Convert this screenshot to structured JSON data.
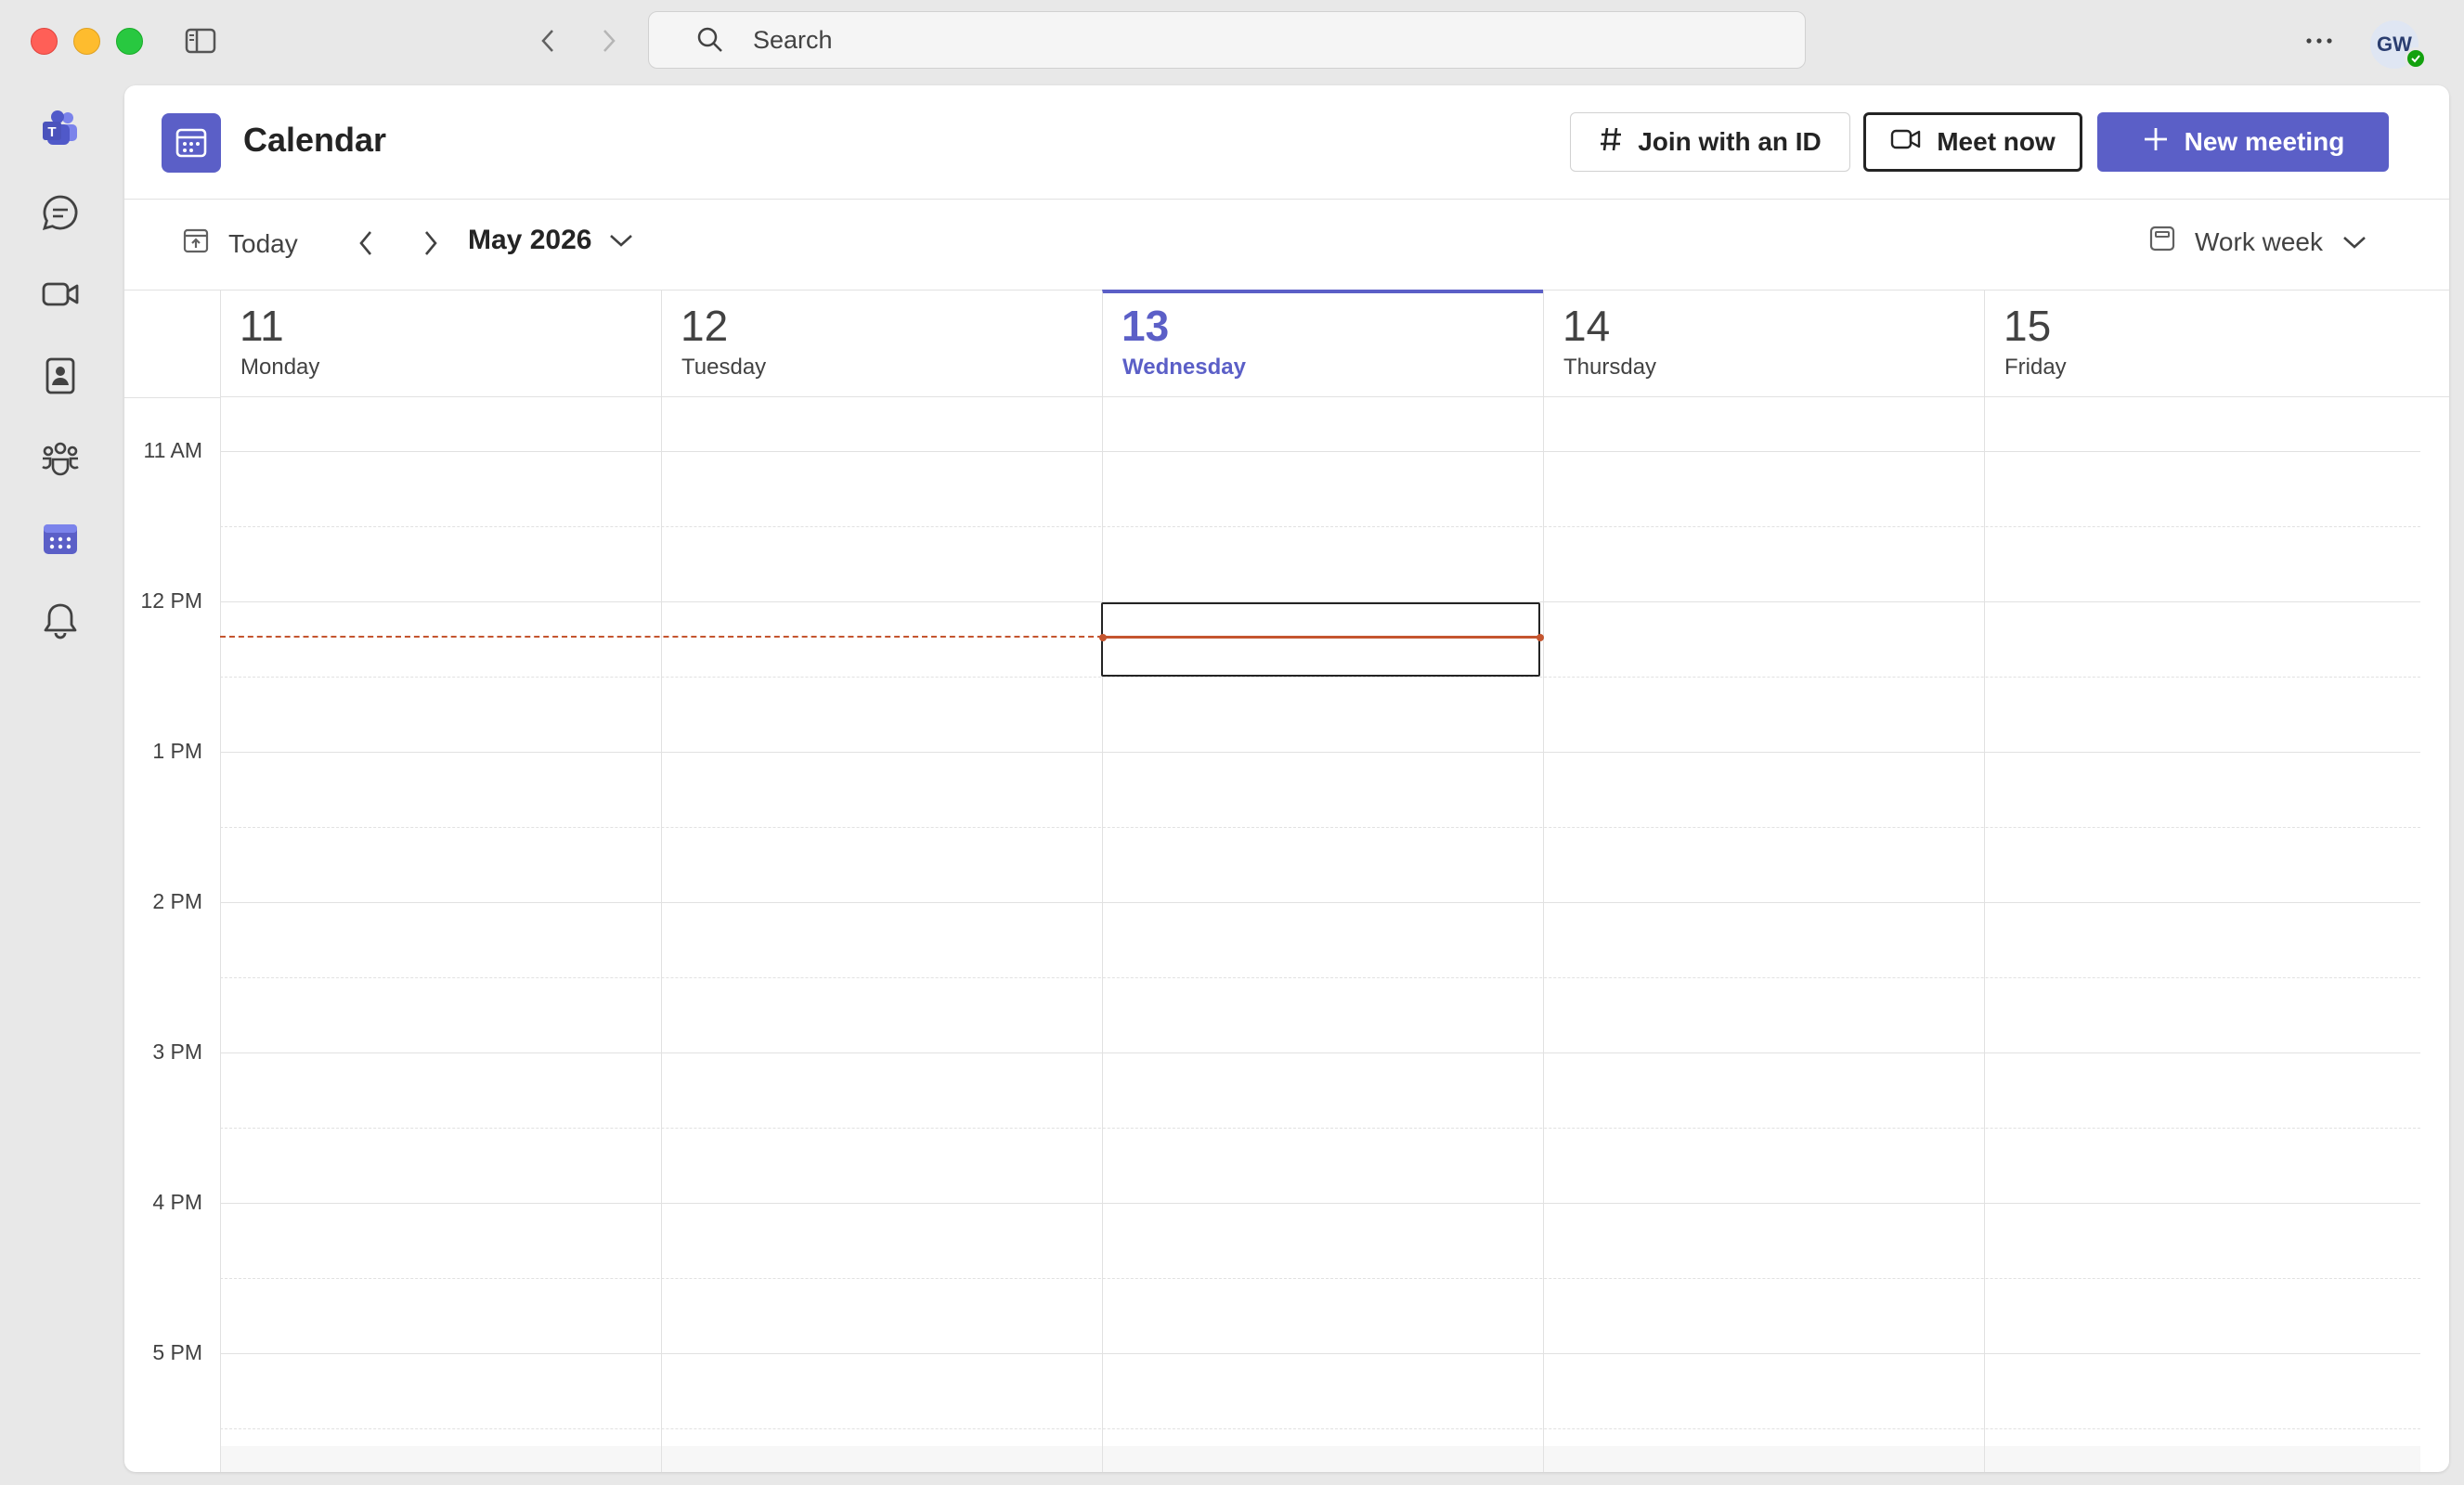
{
  "search": {
    "placeholder": "Search"
  },
  "user": {
    "initials": "GW"
  },
  "calendar": {
    "title": "Calendar",
    "buttons": {
      "join": "Join with an ID",
      "meet": "Meet now",
      "new": "New meeting"
    },
    "toolbar": {
      "today": "Today",
      "month": "May 2026",
      "view": "Work week"
    },
    "days": [
      {
        "num": "11",
        "name": "Monday"
      },
      {
        "num": "12",
        "name": "Tuesday"
      },
      {
        "num": "13",
        "name": "Wednesday"
      },
      {
        "num": "14",
        "name": "Thursday"
      },
      {
        "num": "15",
        "name": "Friday"
      }
    ],
    "times": [
      "11 AM",
      "12 PM",
      "1 PM",
      "2 PM",
      "3 PM",
      "4 PM",
      "5 PM"
    ]
  },
  "colors": {
    "accent": "#5b5fc7",
    "now_line": "#c4552f",
    "presence": "#13a10e"
  }
}
